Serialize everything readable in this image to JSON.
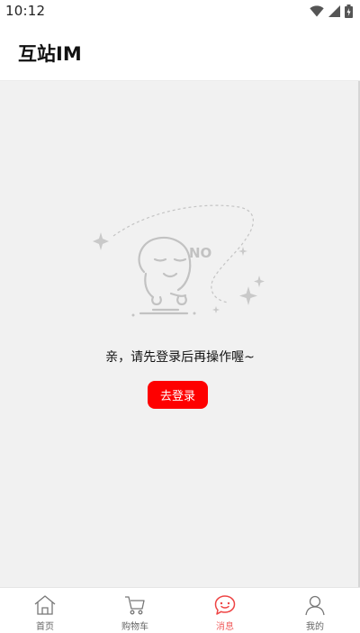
{
  "status_bar": {
    "time": "10:12",
    "icons": [
      "wifi-icon",
      "signal-icon",
      "battery-icon"
    ]
  },
  "header": {
    "title": "互站IM"
  },
  "empty_state": {
    "illustration_text": "NO",
    "message": "亲，请先登录后再操作喔~",
    "button_label": "去登录"
  },
  "tab_bar": {
    "tabs": [
      {
        "label": "首页",
        "icon": "home-icon",
        "active": false
      },
      {
        "label": "购物车",
        "icon": "cart-icon",
        "active": false
      },
      {
        "label": "消息",
        "icon": "message-icon",
        "active": true
      },
      {
        "label": "我的",
        "icon": "user-icon",
        "active": false
      }
    ]
  },
  "colors": {
    "accent": "#fe0000",
    "active_tab": "#f06060",
    "background": "#f1f1f1"
  }
}
